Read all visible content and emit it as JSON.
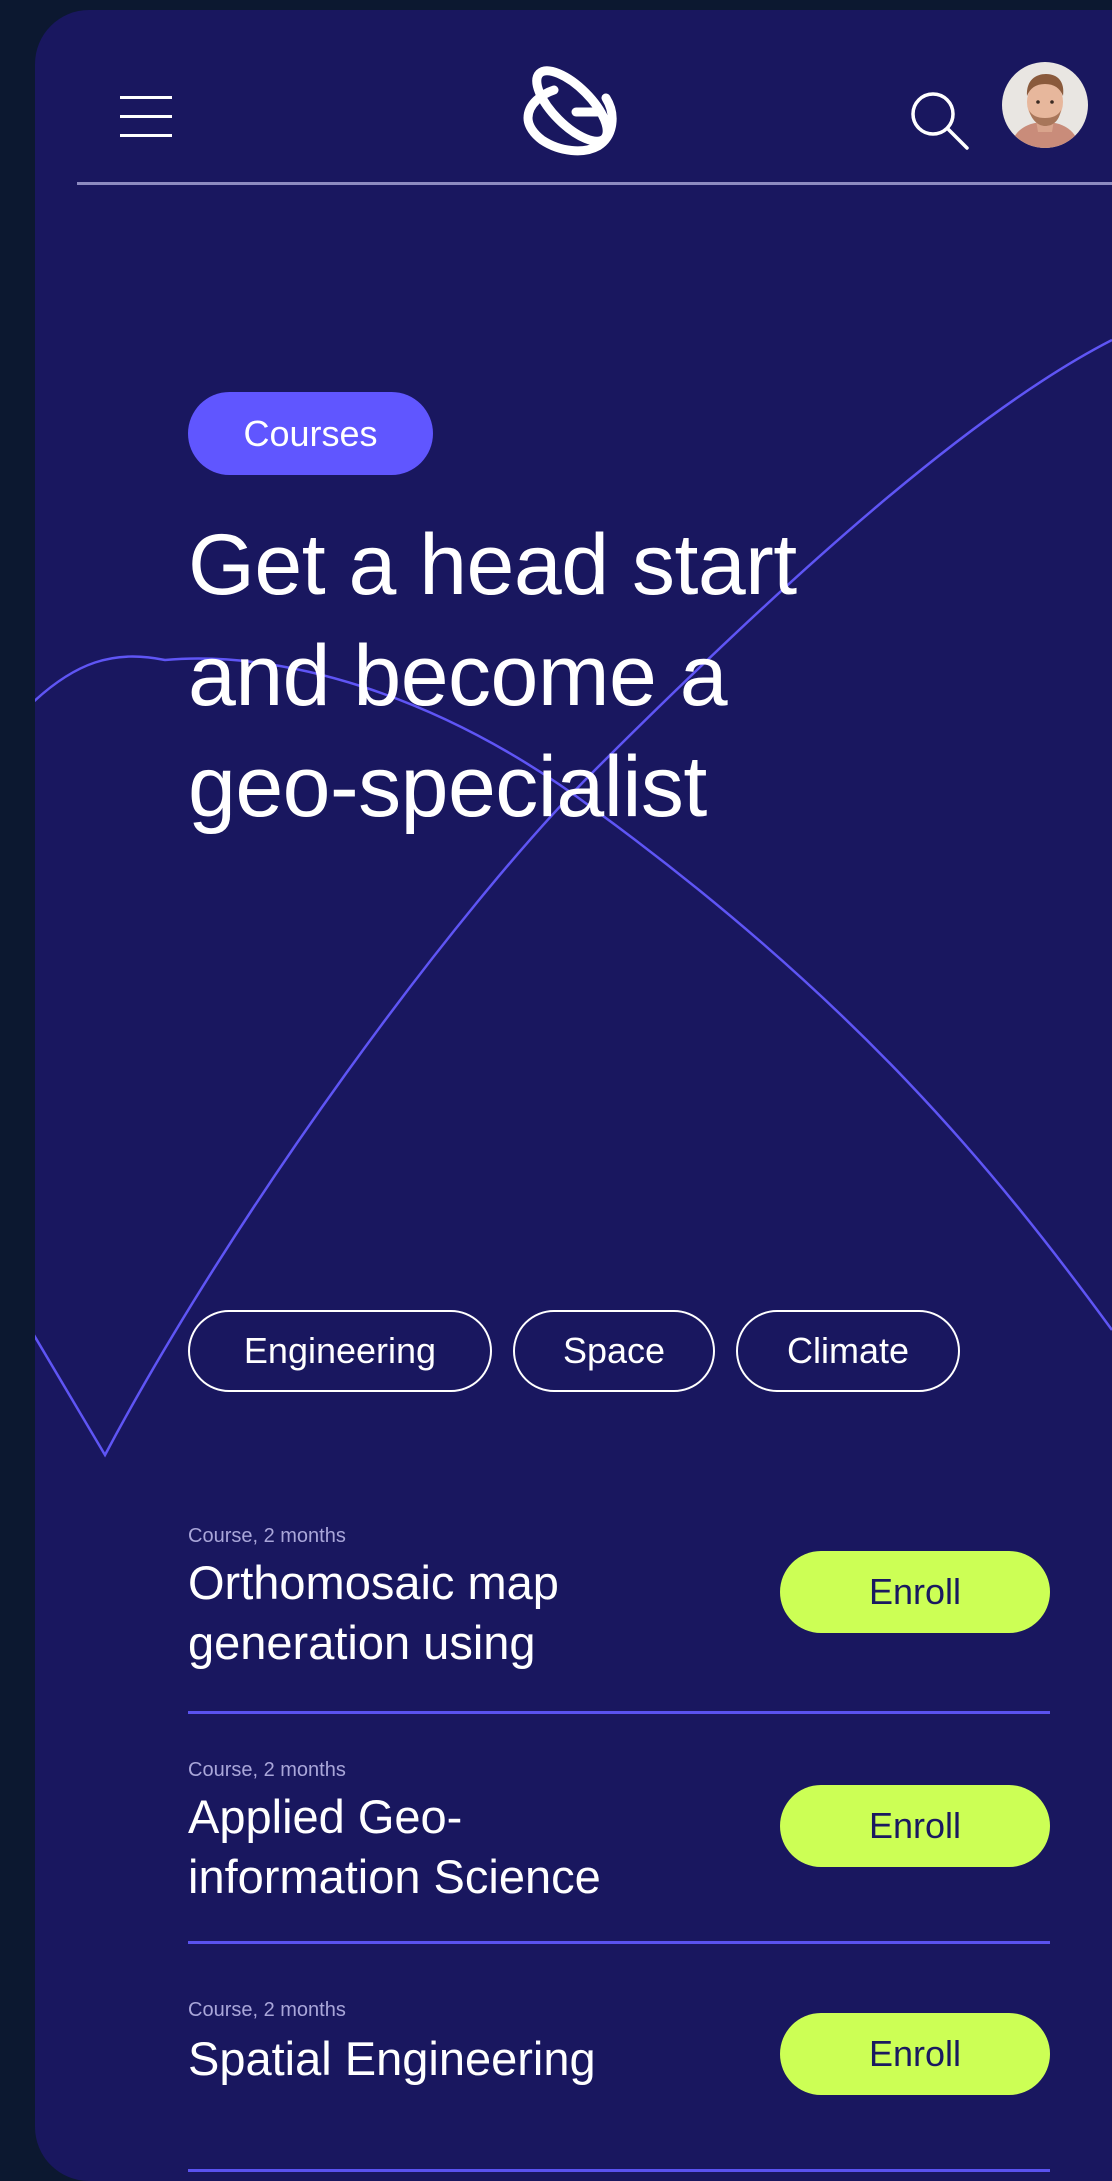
{
  "header": {
    "menu_icon": "hamburger-menu-icon",
    "logo_icon": "atom-g-logo-icon",
    "search_icon": "search-icon",
    "avatar_icon": "user-avatar"
  },
  "hero": {
    "badge": "Courses",
    "headline_line1": "Get a head start",
    "headline_line2": "and become a",
    "headline_line3": "geo-specialist"
  },
  "filters": [
    {
      "label": "Engineering"
    },
    {
      "label": "Space"
    },
    {
      "label": "Climate"
    }
  ],
  "courses": [
    {
      "meta": "Course, 2 months",
      "title_line1": "Orthomosaic map",
      "title_line2": "generation using",
      "button": "Enroll"
    },
    {
      "meta": "Course, 2 months",
      "title_line1": "Applied Geo-",
      "title_line2": "information Science",
      "button": "Enroll"
    },
    {
      "meta": "Course, 2 months",
      "title_line1": "Spatial Engineering",
      "button": "Enroll"
    }
  ],
  "colors": {
    "background": "#19175f",
    "outer": "#0c1830",
    "accent": "#6056ff",
    "button": "#ccff55",
    "text": "#ffffff"
  }
}
